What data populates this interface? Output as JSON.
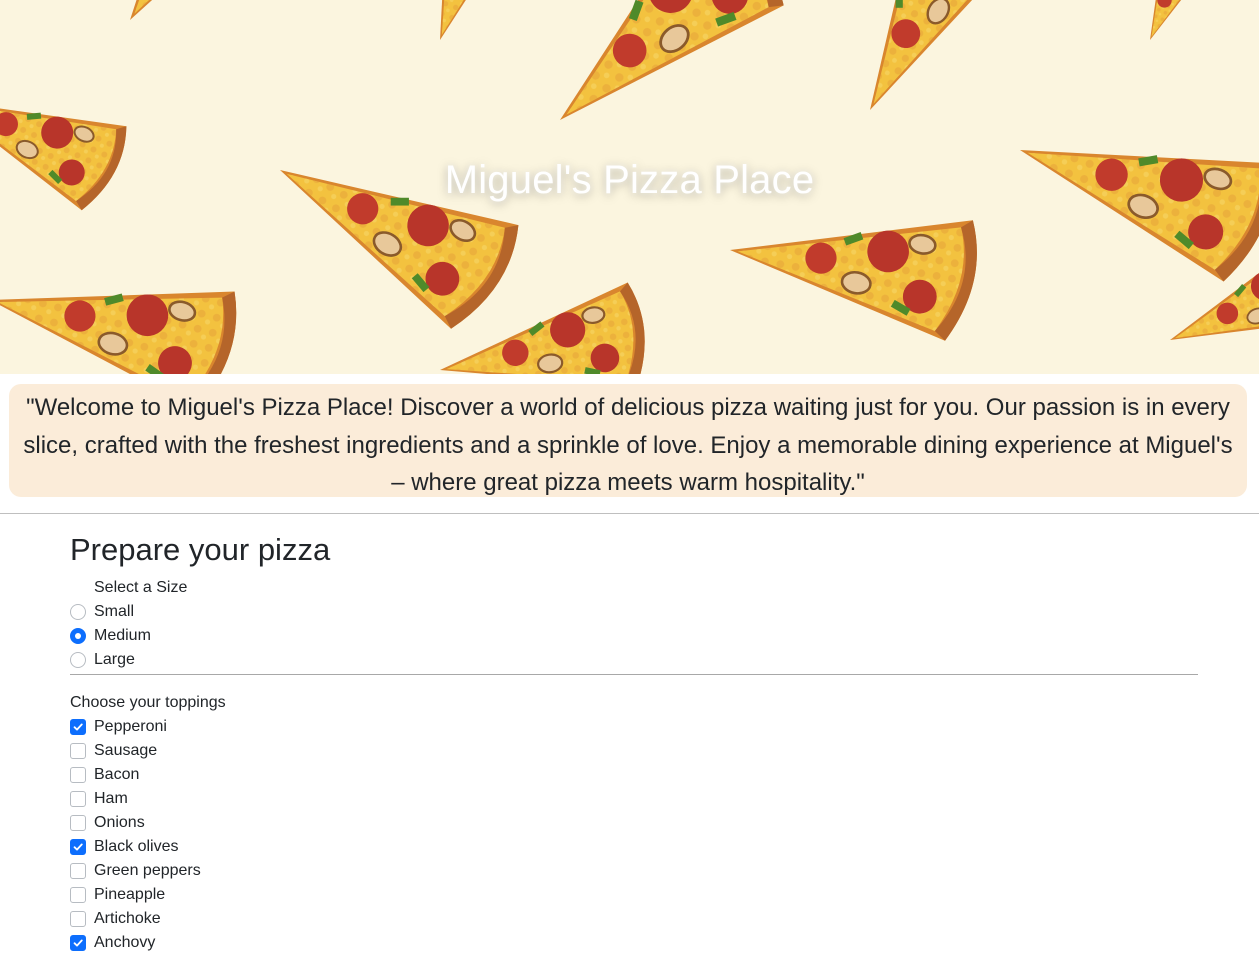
{
  "header": {
    "title": "Miguel's Pizza Place",
    "background_color": "#fbf5df"
  },
  "welcome": {
    "text": "\"Welcome to Miguel's Pizza Place! Discover a world of delicious pizza waiting just for you. Our passion is in every slice, crafted with the freshest ingredients and a sprinkle of love. Enjoy a memorable dining experience at Miguel's – where great pizza meets warm hospitality.\"",
    "background_color": "#fbecd9"
  },
  "form": {
    "heading": "Prepare your pizza",
    "size_label": "Select a Size",
    "sizes": [
      {
        "label": "Small",
        "selected": false
      },
      {
        "label": "Medium",
        "selected": true
      },
      {
        "label": "Large",
        "selected": false
      }
    ],
    "toppings_label": "Choose your toppings",
    "toppings": [
      {
        "label": "Pepperoni",
        "checked": true
      },
      {
        "label": "Sausage",
        "checked": false
      },
      {
        "label": "Bacon",
        "checked": false
      },
      {
        "label": "Ham",
        "checked": false
      },
      {
        "label": "Onions",
        "checked": false
      },
      {
        "label": "Black olives",
        "checked": true
      },
      {
        "label": "Green peppers",
        "checked": false
      },
      {
        "label": "Pineapple",
        "checked": false
      },
      {
        "label": "Artichoke",
        "checked": false
      },
      {
        "label": "Anchovy",
        "checked": true
      }
    ],
    "accent_color": "#0d6efd"
  }
}
